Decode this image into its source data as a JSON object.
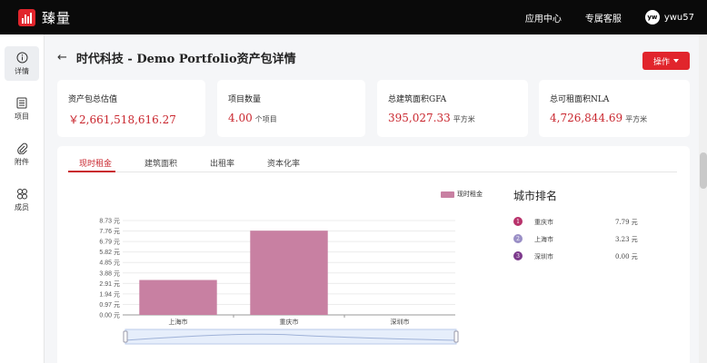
{
  "topbar": {
    "brand": "臻量",
    "links": [
      "应用中心",
      "专属客服"
    ],
    "avatar_initials": "yw",
    "username": "ywu57"
  },
  "sidebar": {
    "items": [
      {
        "label": "详情",
        "icon": "info-icon",
        "active": true
      },
      {
        "label": "项目",
        "icon": "list-icon",
        "active": false
      },
      {
        "label": "附件",
        "icon": "paperclip-icon",
        "active": false
      },
      {
        "label": "成员",
        "icon": "members-icon",
        "active": false
      }
    ]
  },
  "header": {
    "title": "时代科技 - Demo Portfolio资产包详情",
    "action_label": "操作"
  },
  "cards": [
    {
      "label": "资产包总估值",
      "value": "￥2,661,518,616.27",
      "unit": ""
    },
    {
      "label": "项目数量",
      "value": "4.00",
      "unit": "个项目"
    },
    {
      "label": "总建筑面积GFA",
      "value": "395,027.33",
      "unit": "平方米"
    },
    {
      "label": "总可租面积NLA",
      "value": "4,726,844.69",
      "unit": "平方米"
    }
  ],
  "tabs": [
    "现时租金",
    "建筑面积",
    "出租率",
    "资本化率"
  ],
  "chart_data": {
    "type": "bar",
    "categories": [
      "上海市",
      "重庆市",
      "深圳市"
    ],
    "series": [
      {
        "name": "现时租金",
        "values": [
          3.23,
          7.79,
          0.0
        ]
      }
    ],
    "yticks": [
      "0.00 元",
      "0.97 元",
      "1.94 元",
      "2.91 元",
      "3.88 元",
      "4.85 元",
      "5.82 元",
      "6.79 元",
      "7.76 元",
      "8.73 元"
    ],
    "ylim": [
      0,
      8.73
    ],
    "legend": "top-right",
    "color": "#c880a2"
  },
  "ranking": {
    "title": "城市排名",
    "items": [
      {
        "rank": "1",
        "city": "重庆市",
        "value": "7.79 元",
        "color": "#b8326b"
      },
      {
        "rank": "2",
        "city": "上海市",
        "value": "3.23 元",
        "color": "#9a8fc6"
      },
      {
        "rank": "3",
        "city": "深圳市",
        "value": "0.00 元",
        "color": "#7d3a8c"
      }
    ]
  }
}
